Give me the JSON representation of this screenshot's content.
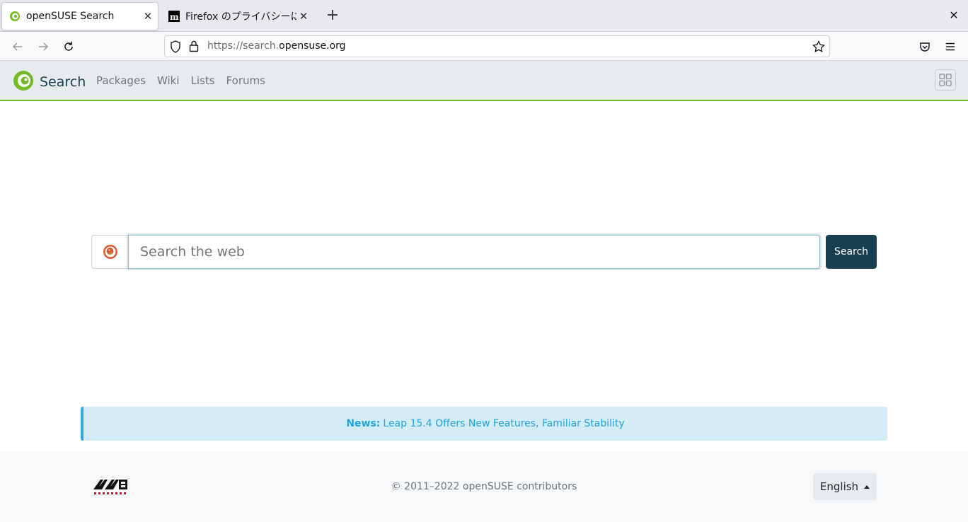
{
  "browser": {
    "tabs": [
      {
        "title": "openSUSE Search",
        "active": true
      },
      {
        "title": "Firefox のプライバシーに関",
        "active": false
      }
    ],
    "url": {
      "prefix": "https://search.",
      "host": "opensuse.org"
    }
  },
  "header": {
    "brand": "Search",
    "nav": [
      "Packages",
      "Wiki",
      "Lists",
      "Forums"
    ]
  },
  "search": {
    "placeholder": "Search the web",
    "button_label": "Search"
  },
  "news": {
    "label": "News:",
    "text": "Leap 15.4 Offers New Features, Familiar Stability"
  },
  "footer": {
    "copyright": "© 2011–2022 openSUSE contributors",
    "language": "English"
  },
  "colors": {
    "brand_green": "#73ba25",
    "brand_dark": "#173f4f",
    "news_blue": "#21a4df"
  }
}
